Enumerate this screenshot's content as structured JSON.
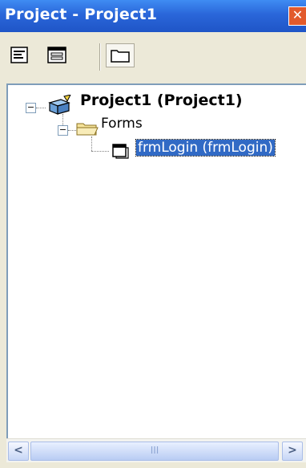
{
  "window": {
    "title": "Project - Project1",
    "close_glyph": "✕"
  },
  "toolbar": {
    "buttons": [
      {
        "name": "view-code-icon"
      },
      {
        "name": "view-object-icon"
      },
      {
        "name": "toggle-folders-icon"
      }
    ]
  },
  "tree": {
    "root": {
      "label": "Project1 (Project1)",
      "icon": "project-icon",
      "expander": "−"
    },
    "folder": {
      "label": "Forms",
      "icon": "folder-icon",
      "expander": "−"
    },
    "item": {
      "label": "frmLogin (frmLogin)",
      "icon": "form-icon",
      "selected": true
    }
  },
  "hscroll": {
    "left_arrow": "<",
    "right_arrow": ">",
    "thumb_grip": "III"
  },
  "colors": {
    "titlebar": "#2a66d9",
    "selection": "#316ac5",
    "close": "#e25a2c"
  }
}
